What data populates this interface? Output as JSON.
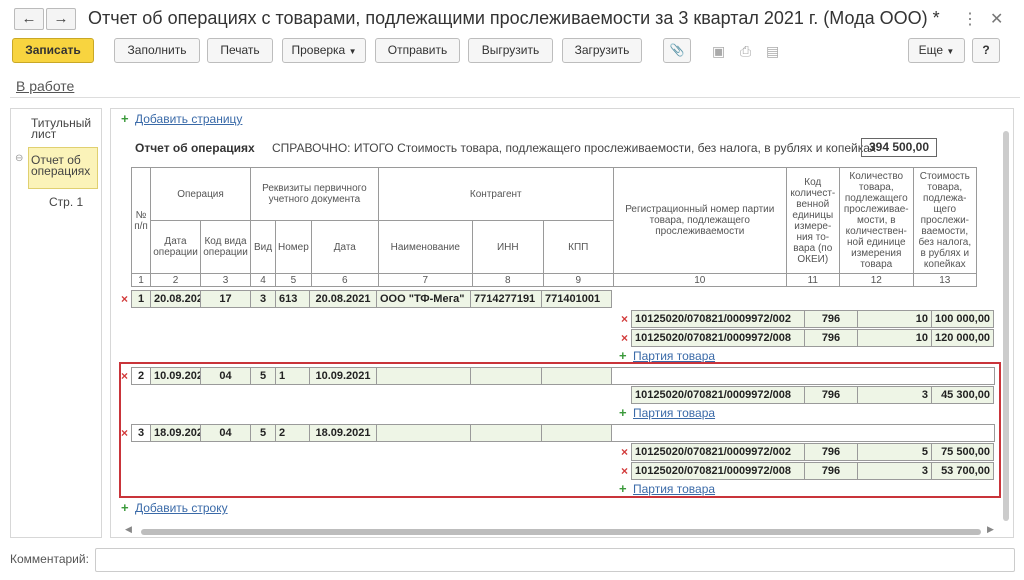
{
  "window": {
    "title": "Отчет об операциях с товарами, подлежащими прослеживаемости за 3 квартал 2021 г. (Мода ООО) *",
    "back": "←",
    "forward": "→"
  },
  "toolbar": {
    "save": "Записать",
    "fill": "Заполнить",
    "print": "Печать",
    "check": "Проверка",
    "send": "Отправить",
    "export": "Выгрузить",
    "import": "Загрузить",
    "more": "Еще",
    "help": "?"
  },
  "status": "В работе",
  "left_panel": {
    "title_sheet": "Титульный лист",
    "report": "Отчет об операциях",
    "page": "Стр. 1"
  },
  "main": {
    "add_page": "Добавить страницу",
    "section_title": "Отчет об операциях",
    "ref_text": "СПРАВОЧНО: ИТОГО Стоимость товара, подлежащего прослеживаемости, без налога, в рублях и копейках",
    "total": "394 500,00",
    "add_row": "Добавить строку",
    "add_batch": "Партия товара"
  },
  "headers": {
    "npp": "№ п/п",
    "operation": "Операция",
    "requisites": "Реквизиты первичного учетного документа",
    "counterparty": "Контрагент",
    "reg_number": "Регистрационный номер партии товара, подлежащего прослеживаемости",
    "unit_code": "Код количест-венной единицы измере-ния то-вара (по ОКЕИ)",
    "qty": "Количество товара, подлежащего прослеживае-мости, в количествен-ной единице измерения товара",
    "cost": "Стоимость товара, подлежа-щего прослежи-ваемости, без налога, в рублях и копейках",
    "op_date": "Дата операции",
    "op_code": "Код вида операции",
    "doc_type": "Вид",
    "doc_number": "Номер",
    "doc_date": "Дата",
    "name": "Наименование",
    "inn": "ИНН",
    "kpp": "КПП",
    "nums": [
      "1",
      "2",
      "3",
      "4",
      "5",
      "6",
      "7",
      "8",
      "9",
      "10",
      "11",
      "12",
      "13"
    ]
  },
  "rows": [
    {
      "n": "1",
      "date": "20.08.2021",
      "code": "17",
      "vid": "3",
      "num": "613",
      "ddate": "20.08.2021",
      "name": "ООО \"ТФ-Мега\"",
      "inn": "7714277191",
      "kpp": "771401001",
      "batches": [
        {
          "reg": "10125020/070821/0009972/002",
          "okei": "796",
          "qty": "10",
          "cost": "100 000,00"
        },
        {
          "reg": "10125020/070821/0009972/008",
          "okei": "796",
          "qty": "10",
          "cost": "120 000,00"
        }
      ]
    },
    {
      "n": "2",
      "date": "10.09.2021",
      "code": "04",
      "vid": "5",
      "num": "1",
      "ddate": "10.09.2021",
      "name": "",
      "inn": "",
      "kpp": "",
      "batches": [
        {
          "reg": "10125020/070821/0009972/008",
          "okei": "796",
          "qty": "3",
          "cost": "45 300,00"
        }
      ]
    },
    {
      "n": "3",
      "date": "18.09.2021",
      "code": "04",
      "vid": "5",
      "num": "2",
      "ddate": "18.09.2021",
      "name": "",
      "inn": "",
      "kpp": "",
      "batches": [
        {
          "reg": "10125020/070821/0009972/002",
          "okei": "796",
          "qty": "5",
          "cost": "75 500,00"
        },
        {
          "reg": "10125020/070821/0009972/008",
          "okei": "796",
          "qty": "3",
          "cost": "53 700,00"
        }
      ]
    }
  ],
  "comment_label": "Комментарий:"
}
